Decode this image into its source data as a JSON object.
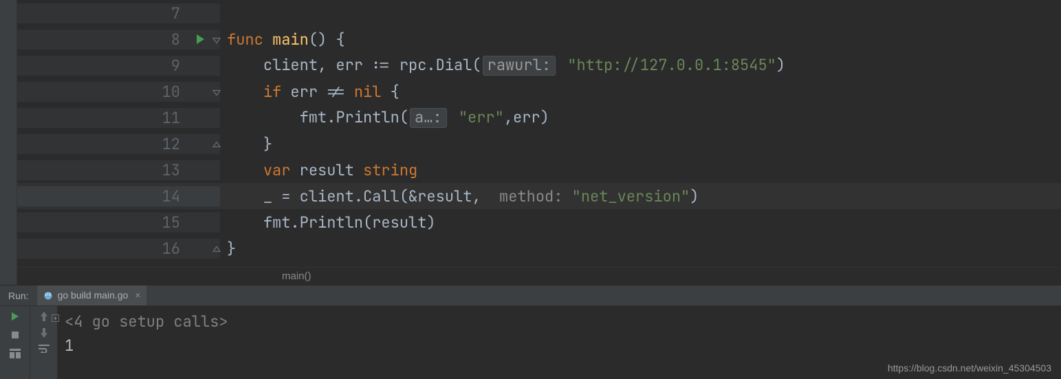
{
  "editor": {
    "gutter_play_line": 8,
    "breadcrumb": "main()",
    "lines": [
      {
        "num": "7",
        "tokens": []
      },
      {
        "num": "8",
        "tokens": [
          {
            "t": "kw",
            "v": "func "
          },
          {
            "t": "fnname",
            "v": "main"
          },
          {
            "t": "ident",
            "v": "() {"
          }
        ],
        "fold": "open-down"
      },
      {
        "num": "9",
        "indent": 1,
        "tokens": [
          {
            "t": "ident",
            "v": "client, err := rpc."
          },
          {
            "t": "ident",
            "v": "Dial("
          },
          {
            "t": "labelbox",
            "v": "rawurl:"
          },
          {
            "t": "str",
            "v": "\"http://127.0.0.1:8545\""
          },
          {
            "t": "ident",
            "v": ")"
          }
        ]
      },
      {
        "num": "10",
        "indent": 1,
        "tokens": [
          {
            "t": "kw",
            "v": "if "
          },
          {
            "t": "ident",
            "v": "err != "
          },
          {
            "t": "kw",
            "v": "nil"
          },
          {
            "t": "ident",
            "v": " {"
          }
        ],
        "fold": "open-down"
      },
      {
        "num": "11",
        "indent": 2,
        "tokens": [
          {
            "t": "ident",
            "v": "fmt."
          },
          {
            "t": "ident",
            "v": "Println("
          },
          {
            "t": "labelbox",
            "v": "a…:"
          },
          {
            "t": "str",
            "v": "\"err\""
          },
          {
            "t": "ident",
            "v": ",err)"
          }
        ]
      },
      {
        "num": "12",
        "indent": 1,
        "tokens": [
          {
            "t": "ident",
            "v": "}"
          }
        ],
        "fold": "open-up"
      },
      {
        "num": "13",
        "indent": 1,
        "tokens": [
          {
            "t": "kw",
            "v": "var "
          },
          {
            "t": "ident",
            "v": "result "
          },
          {
            "t": "type",
            "v": "string"
          }
        ]
      },
      {
        "num": "14",
        "indent": 1,
        "hl": true,
        "tokens": [
          {
            "t": "ident",
            "v": "_ = client.Call(&result,  "
          },
          {
            "t": "label",
            "v": "method: "
          },
          {
            "t": "str",
            "v": "\"net_version\""
          },
          {
            "t": "ident",
            "v": ")"
          }
        ]
      },
      {
        "num": "15",
        "indent": 1,
        "tokens": [
          {
            "t": "ident",
            "v": "fmt."
          },
          {
            "t": "ident",
            "v": "Println(result)"
          }
        ]
      },
      {
        "num": "16",
        "tokens": [
          {
            "t": "ident",
            "v": "}"
          }
        ],
        "fold": "open-up"
      }
    ]
  },
  "run": {
    "label": "Run:",
    "tab_title": "go build main.go",
    "setup_line": "<4 go setup calls>",
    "output": "1"
  },
  "watermark": "https://blog.csdn.net/weixin_45304503"
}
